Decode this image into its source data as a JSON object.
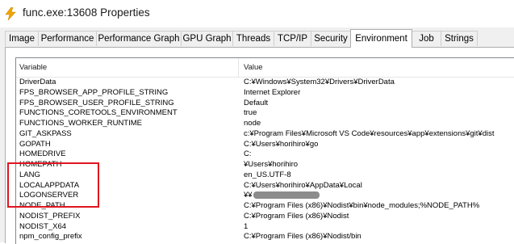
{
  "window": {
    "title": "func.exe:13608 Properties",
    "icon": "lightning-bolt-icon"
  },
  "tabs": [
    {
      "label": "Image",
      "active": false
    },
    {
      "label": "Performance",
      "active": false
    },
    {
      "label": "Performance Graph",
      "active": false
    },
    {
      "label": "GPU Graph",
      "active": false
    },
    {
      "label": "Threads",
      "active": false
    },
    {
      "label": "TCP/IP",
      "active": false
    },
    {
      "label": "Security",
      "active": false
    },
    {
      "label": "Environment",
      "active": true
    },
    {
      "label": "Job",
      "active": false
    },
    {
      "label": "Strings",
      "active": false
    }
  ],
  "table": {
    "columns": [
      "Variable",
      "Value"
    ],
    "rows": [
      {
        "variable": "DriverData",
        "value": "C:¥Windows¥System32¥Drivers¥DriverData"
      },
      {
        "variable": "FPS_BROWSER_APP_PROFILE_STRING",
        "value": "Internet Explorer"
      },
      {
        "variable": "FPS_BROWSER_USER_PROFILE_STRING",
        "value": "Default"
      },
      {
        "variable": "FUNCTIONS_CORETOOLS_ENVIRONMENT",
        "value": "true"
      },
      {
        "variable": "FUNCTIONS_WORKER_RUNTIME",
        "value": "node"
      },
      {
        "variable": "GIT_ASKPASS",
        "value": "c:¥Program Files¥Microsoft VS Code¥resources¥app¥extensions¥git¥dist"
      },
      {
        "variable": "GOPATH",
        "value": "C:¥Users¥horihiro¥go"
      },
      {
        "variable": "HOMEDRIVE",
        "value": "C:"
      },
      {
        "variable": "HOMEPATH",
        "value": "¥Users¥horihiro"
      },
      {
        "variable": "LANG",
        "value": "en_US.UTF-8"
      },
      {
        "variable": "LOCALAPPDATA",
        "value": "C:¥Users¥horihiro¥AppData¥Local"
      },
      {
        "variable": "LOGONSERVER",
        "value": "¥¥",
        "redacted": true
      },
      {
        "variable": "NODE_PATH",
        "value": "C:¥Program Files (x86)¥Nodist¥bin¥node_modules;%NODE_PATH%"
      },
      {
        "variable": "NODIST_PREFIX",
        "value": "C:¥Program Files (x86)¥Nodist"
      },
      {
        "variable": "NODIST_X64",
        "value": "1"
      },
      {
        "variable": "npm_config_prefix",
        "value": "C:¥Program Files (x86)¥Nodist/bin"
      }
    ]
  },
  "annotation": {
    "color": "#e0161f"
  }
}
